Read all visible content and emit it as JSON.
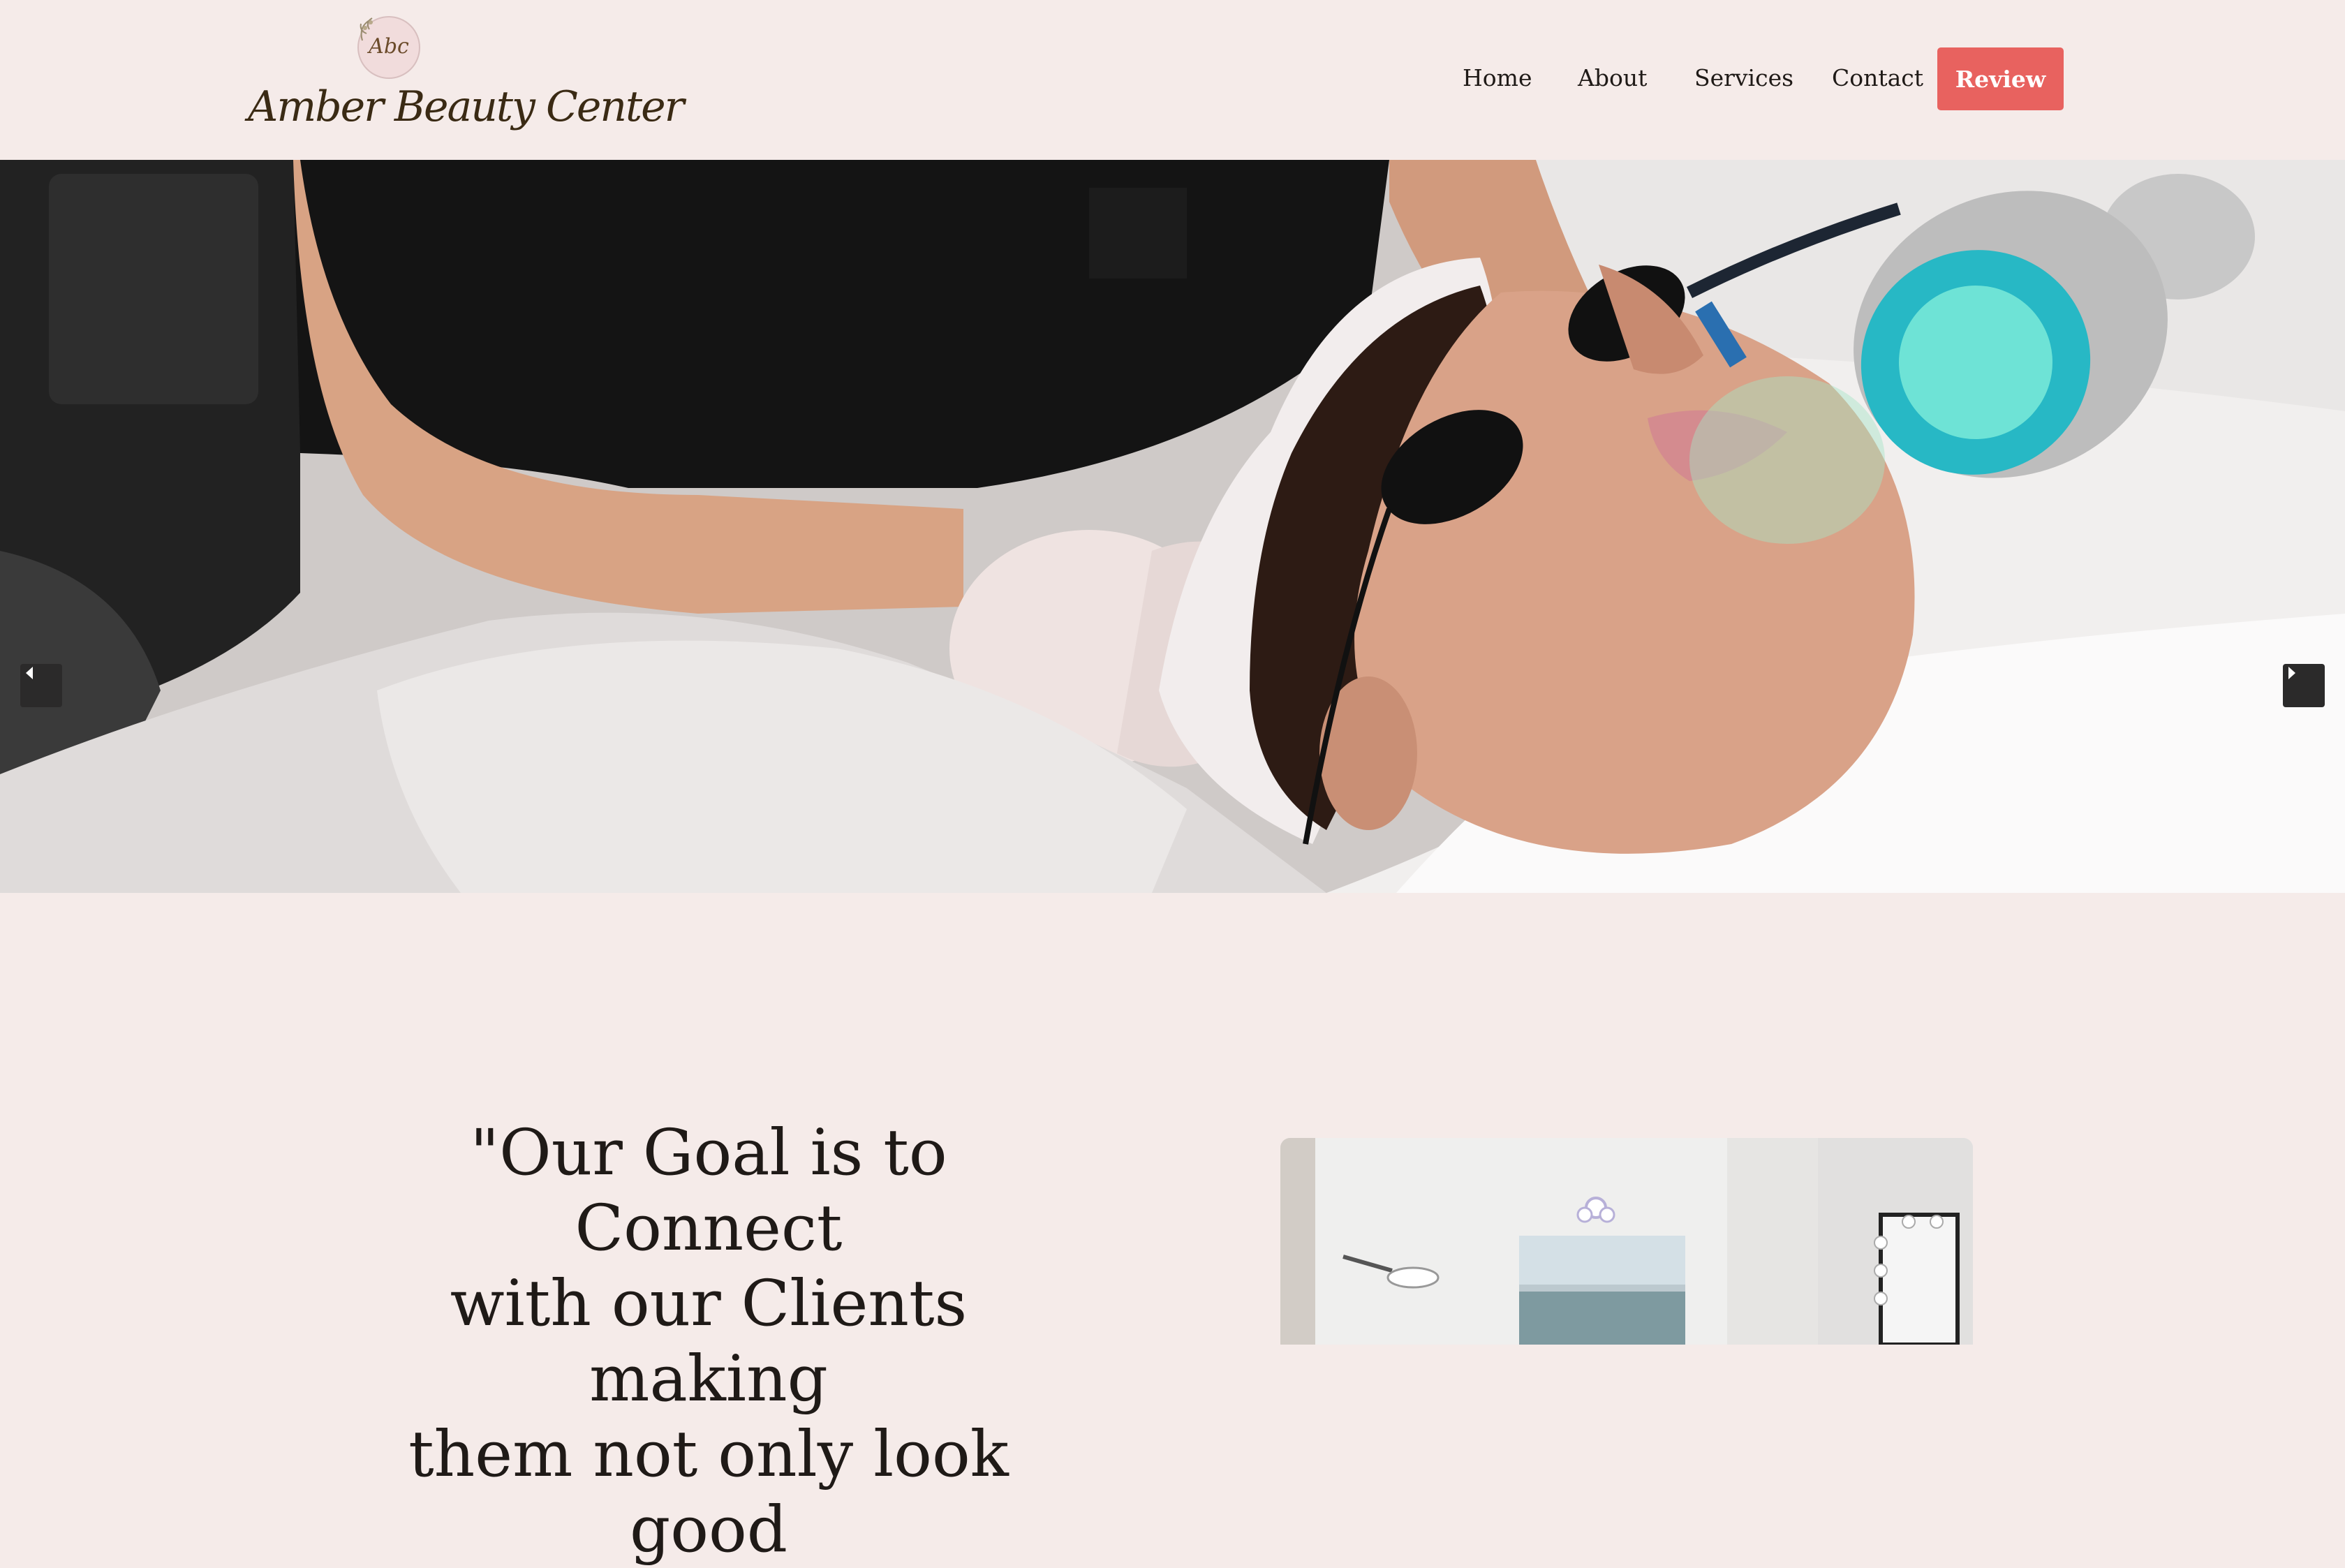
{
  "brand": {
    "name": "Amber Beauty Center",
    "monogram": "Abc"
  },
  "nav": {
    "items": [
      {
        "label": "Home"
      },
      {
        "label": "About"
      },
      {
        "label": "Services"
      },
      {
        "label": "Contact"
      }
    ],
    "cta_label": "Review"
  },
  "colors": {
    "background": "#f5ebe9",
    "accent": "#e8625f",
    "text": "#1f1a17",
    "logo": "#3a2a14"
  },
  "hero": {
    "prev_icon": "chevron-left-icon",
    "next_icon": "chevron-right-icon"
  },
  "goal": {
    "quote_lines": [
      "\"Our Goal is to Connect",
      "with our Clients making",
      "them not only look good"
    ]
  }
}
